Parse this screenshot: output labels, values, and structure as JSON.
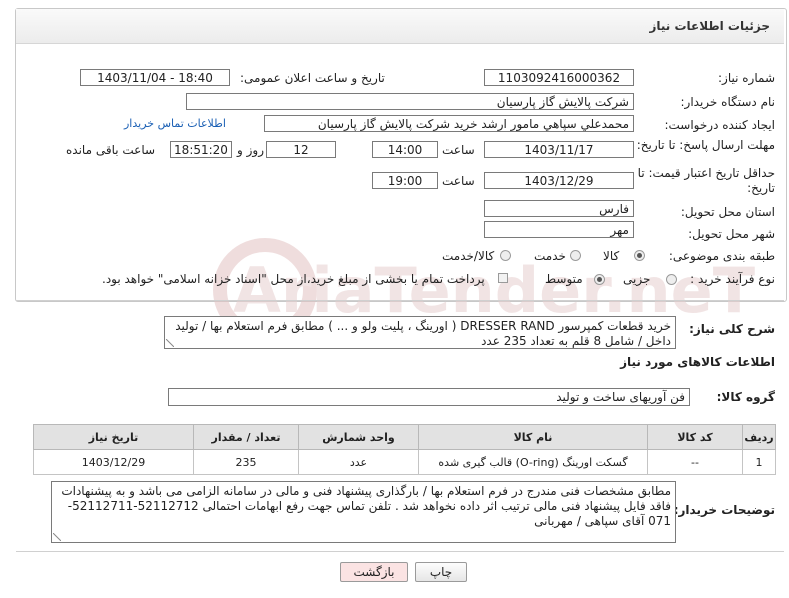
{
  "header": {
    "title": "جزئیات اطلاعات نیاز"
  },
  "form": {
    "need_number_label": "شماره نیاز:",
    "need_number": "1103092416000362",
    "announce_label": "تاریخ و ساعت اعلان عمومی:",
    "announce_value": "1403/11/04 - 18:40",
    "buyer_org_label": "نام دستگاه خریدار:",
    "buyer_org": "شرکت پالایش گاز پارسیان",
    "creator_label": "ایجاد کننده درخواست:",
    "creator": "محمدعلي سپاهي مامور ارشد خرید شرکت پالایش گاز پارسیان",
    "contact_link": "اطلاعات تماس خریدار",
    "reply_deadline_label": "مهلت ارسال پاسخ: تا تاریخ:",
    "reply_date": "1403/11/17",
    "time_word": "ساعت",
    "reply_time": "14:00",
    "days_value": "12",
    "days_word": "روز و",
    "remaining_time": "18:51:20",
    "remaining_word": "ساعت باقی مانده",
    "validity_label": "حداقل تاریخ اعتبار قیمت: تا تاریخ:",
    "validity_date": "1403/12/29",
    "validity_time": "19:00",
    "province_label": "استان محل تحویل:",
    "province": "فارس",
    "city_label": "شهر محل تحویل:",
    "city": "مهر",
    "category_label": "طبقه بندی موضوعی:",
    "category_options": [
      "کالا",
      "خدمت",
      "کالا/خدمت"
    ],
    "category_selected": "کالا",
    "process_label": "نوع فرآیند خرید :",
    "process_options": [
      "جزیی",
      "متوسط"
    ],
    "process_selected": "متوسط",
    "payment_note": "پرداخت تمام یا بخشی از مبلغ خرید،از محل \"اسناد خزانه اسلامی\" خواهد بود."
  },
  "description": {
    "label": "شرح کلی نیاز:",
    "text": "خرید قطعات کمپرسور DRESSER RAND ( اورینگ ، پلیت ولو و ... ) مطابق فرم استعلام بها / تولید داخل / شامل 8 قلم به تعداد 235 عدد"
  },
  "goods_section": {
    "title": "اطلاعات کالاهای مورد نیاز",
    "group_label": "گروه کالا:",
    "group_value": "فن آوریهای ساخت و تولید"
  },
  "table": {
    "headers": [
      "ردیف",
      "کد کالا",
      "نام کالا",
      "واحد شمارش",
      "تعداد / مقدار",
      "تاریخ نیاز"
    ],
    "rows": [
      {
        "row": "1",
        "code": "--",
        "name": "گسکت اورینگ (O-ring) قالب گیری شده",
        "unit": "عدد",
        "qty": "235",
        "date": "1403/12/29"
      }
    ]
  },
  "buyer_notes": {
    "label": "توضیحات خریدار:",
    "text": "مطابق مشخصات فنی مندرج در فرم استعلام بها / بارگذاری پیشنهاد فنی و مالی در سامانه الزامی می باشد و به پیشنهادات فاقد فایل پیشنهاد فنی مالی ترتیب اثر داده نخواهد شد . تلفن تماس جهت رفع ابهامات احتمالی 52112712-52112711-071 آقای سپاهی / مهربانی"
  },
  "buttons": {
    "print": "چاپ",
    "back": "بازگشت"
  },
  "watermark": {
    "text": "AriaTender.neT"
  },
  "colors": {
    "link": "#1a5fb4",
    "back_button_bg": "#fbe3e3",
    "header_bg": "#ececec",
    "watermark": "#e6c9c9"
  }
}
